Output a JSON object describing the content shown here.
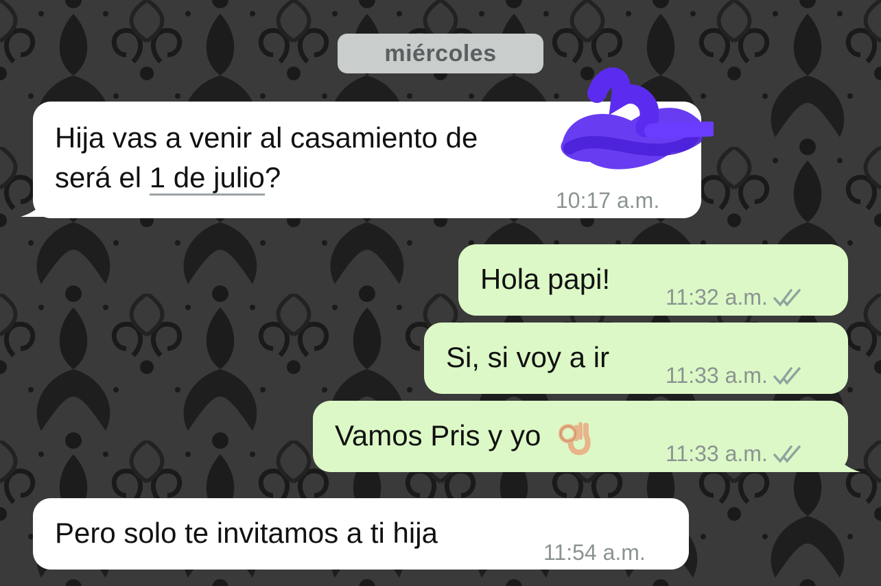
{
  "chat": {
    "date_label": "miércoles",
    "messages": [
      {
        "direction": "incoming",
        "text_line1": "Hija vas a venir al casamiento de",
        "text_line2_pre": "será el ",
        "text_line2_link": "1 de julio",
        "text_line2_post": "?",
        "time": "10:17 a.m."
      },
      {
        "direction": "outgoing",
        "text": "Hola papi!",
        "time": "11:32 a.m.",
        "status": "read-double-check"
      },
      {
        "direction": "outgoing",
        "text": "Si, si voy a ir",
        "time": "11:33 a.m.",
        "status": "read-double-check"
      },
      {
        "direction": "outgoing",
        "text": "Vamos Pris y yo",
        "emoji": "ok-hand",
        "time": "11:33 a.m.",
        "status": "read-double-check"
      },
      {
        "direction": "incoming",
        "text": "Pero solo te invitamos a ti hija",
        "time": "11:54 a.m."
      }
    ]
  },
  "colors": {
    "incoming_bubble": "#ffffff",
    "outgoing_bubble": "#dcf8c6",
    "timestamp": "#8a9392",
    "date_chip": "#c9cdcc",
    "redaction": "#5b2cf0"
  },
  "icons": {
    "check": "double-check-icon",
    "emoji": "ok-hand-icon",
    "redaction": "scribble-redaction"
  }
}
